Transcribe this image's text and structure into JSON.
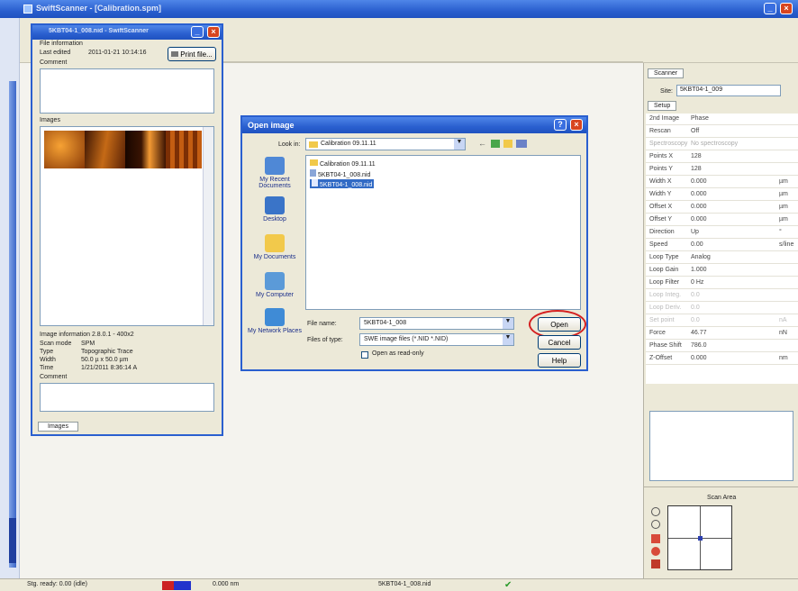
{
  "app": {
    "title": "SwiftScanner - [Calibration.spm]",
    "status_text": "Stg. ready: 0.00 (idle)",
    "status_zoom": "0.000 nm",
    "status_file": "5KBT04-1_008.nid"
  },
  "file_window": {
    "title": "5KBT04-1_008.nid - SwiftScanner",
    "file_info_label": "File information",
    "last_edited_label": "Last edited",
    "last_edited_value": "2011-01-21 10:14:16",
    "print_button": "Print file...",
    "comment_label": "Comment",
    "images_label": "Images",
    "image_info_title": "Image information 2.8.0.1 - 400x2",
    "meta": [
      {
        "label": "Scan mode",
        "value": "SPM"
      },
      {
        "label": "Type",
        "value": "Topographic Trace"
      },
      {
        "label": "Width",
        "value": "50.0 µ x 50.0 µm"
      },
      {
        "label": "Time",
        "value": "1/21/2011 8:36:14 A"
      }
    ],
    "comment2_label": "Comment",
    "images_tab": "Images"
  },
  "open_dialog": {
    "title": "Open image",
    "look_in_label": "Look in:",
    "look_in_value": "Calibration 09.11.11",
    "places": [
      "My Recent Documents",
      "Desktop",
      "My Documents",
      "My Computer",
      "My Network Places"
    ],
    "files": [
      "Calibration 09.11.11",
      "5KBT04-1_008.nid",
      "5KBT04-1_008.nid"
    ],
    "file_name_label": "File name:",
    "file_name_value": "5KBT04-1_008",
    "files_of_type_label": "Files of type:",
    "files_of_type_value": "SWE image files (*.NID *.NID)",
    "readonly_label": "Open as read-only",
    "open_button": "Open",
    "cancel_button": "Cancel",
    "help_button": "Help"
  },
  "right_panel": {
    "tab_scanner": "Scanner",
    "site_label": "Site:",
    "site_value": "5KBT04-1_009",
    "tab_setup": "Setup",
    "properties": [
      {
        "label": "2nd Image",
        "value": "Phase",
        "unit": ""
      },
      {
        "label": "Rescan",
        "value": "Off",
        "unit": ""
      },
      {
        "label": "Spectroscopy",
        "value": "No spectroscopy",
        "unit": ""
      },
      {
        "label": "Points X",
        "value": "128",
        "unit": ""
      },
      {
        "label": "Points Y",
        "value": "128",
        "unit": ""
      },
      {
        "label": "Width X",
        "value": "0.000",
        "unit": "µm"
      },
      {
        "label": "Width Y",
        "value": "0.000",
        "unit": "µm"
      },
      {
        "label": "Offset X",
        "value": "0.000",
        "unit": "µm"
      },
      {
        "label": "Offset Y",
        "value": "0.000",
        "unit": "µm"
      },
      {
        "label": "Direction",
        "value": "Up",
        "unit": "°"
      },
      {
        "label": "Speed",
        "value": "0.00",
        "unit": "s/line"
      },
      {
        "label": "Loop Type",
        "value": "Analog",
        "unit": ""
      },
      {
        "label": "Loop Gain",
        "value": "1.000",
        "unit": ""
      },
      {
        "label": "Loop Filter",
        "value": "0 Hz",
        "unit": ""
      },
      {
        "label": "Loop Integ.",
        "value": "0.0",
        "unit": ""
      },
      {
        "label": "Loop Deriv.",
        "value": "0.0",
        "unit": ""
      },
      {
        "label": "Set point",
        "value": "0.0",
        "unit": "nA"
      },
      {
        "label": "Force",
        "value": "46.77",
        "unit": "nN"
      },
      {
        "label": "Phase Shift",
        "value": "786.0",
        "unit": ""
      },
      {
        "label": "Z-Offset",
        "value": "0.000",
        "unit": "nm"
      }
    ],
    "scan_area_title": "Scan Area"
  },
  "colors": {
    "accent": "#2a5fcf",
    "highlight_circle": "#d42020"
  }
}
